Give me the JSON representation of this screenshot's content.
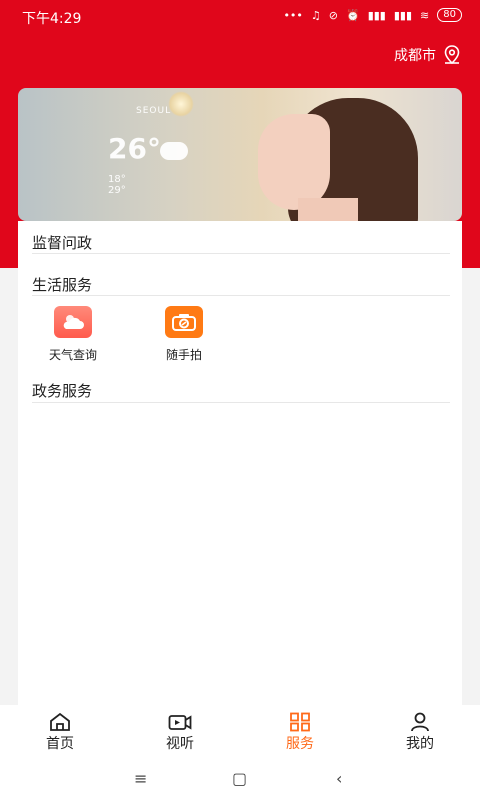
{
  "status": {
    "time": "下午4:29",
    "battery": "80"
  },
  "location": {
    "city": "成都市",
    "icon": "location-pin-icon"
  },
  "banner": {
    "weather_city": "SEOUL",
    "weather_temp": "26°",
    "weather_low": "18°",
    "weather_high": "29°"
  },
  "sections": {
    "supervision_title": "监督问政",
    "life_title": "生活服务",
    "gov_title": "政务服务"
  },
  "services": [
    {
      "label": "天气查询",
      "icon": "weather-icon",
      "color": "#ff6a5a"
    },
    {
      "label": "随手拍",
      "icon": "camera-icon",
      "color": "#ff7a14"
    }
  ],
  "nav": [
    {
      "label": "首页",
      "icon": "home-icon"
    },
    {
      "label": "视听",
      "icon": "video-icon"
    },
    {
      "label": "服务",
      "icon": "grid-icon",
      "active": true
    },
    {
      "label": "我的",
      "icon": "user-icon"
    }
  ],
  "accent": "#ff6a1a",
  "header_red": "#e0061b"
}
